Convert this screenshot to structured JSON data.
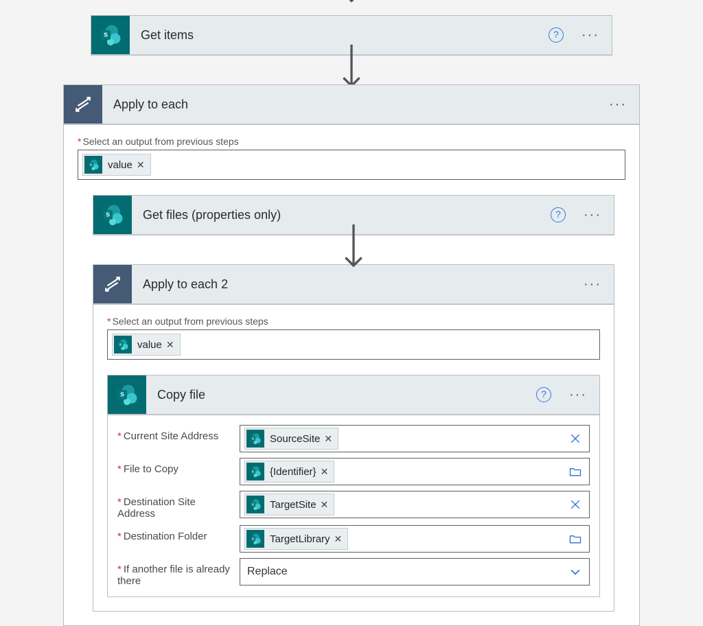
{
  "actions": {
    "get_items": {
      "title": "Get items"
    },
    "get_files": {
      "title": "Get files (properties only)"
    },
    "copy_file": {
      "title": "Copy file"
    }
  },
  "loops": {
    "outer": {
      "title": "Apply to each",
      "select_label": "Select an output from previous steps",
      "token": "value"
    },
    "inner": {
      "title": "Apply to each 2",
      "select_label": "Select an output from previous steps",
      "token": "value"
    }
  },
  "copy_params": {
    "current_site": {
      "label": "Current Site Address",
      "token": "SourceSite"
    },
    "file_to_copy": {
      "label": "File to Copy",
      "token": "{Identifier}"
    },
    "dest_site": {
      "label": "Destination Site Address",
      "token": "TargetSite"
    },
    "dest_folder": {
      "label": "Destination Folder",
      "token": "TargetLibrary"
    },
    "overwrite": {
      "label": "If another file is already there",
      "value": "Replace"
    }
  }
}
